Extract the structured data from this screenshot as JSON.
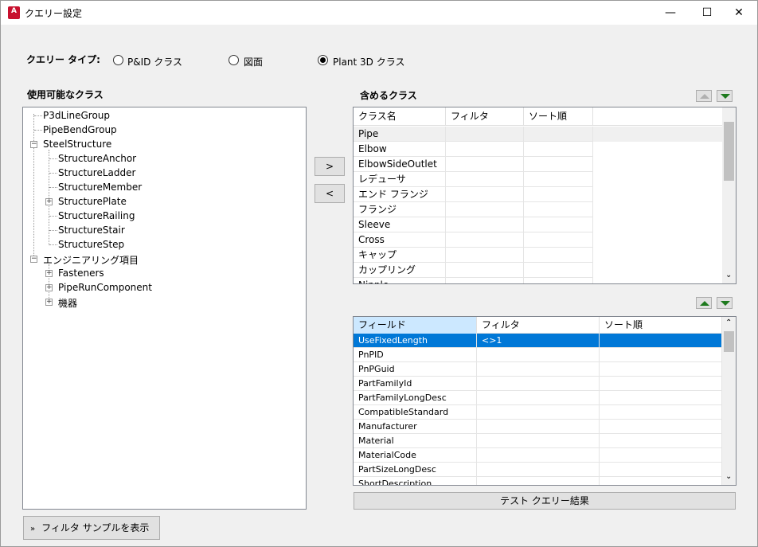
{
  "window": {
    "title": "クエリー設定",
    "icon": "autocad-plant-icon",
    "app_icon_letter": "A"
  },
  "query_type": {
    "label": "クエリー タイプ:",
    "options": [
      {
        "label": "P&ID クラス",
        "selected": false
      },
      {
        "label": "図面",
        "selected": false
      },
      {
        "label": "Plant 3D クラス",
        "selected": true
      }
    ]
  },
  "available": {
    "title": "使用可能なクラス",
    "tree": [
      {
        "label": "P3dLineGroup"
      },
      {
        "label": "PipeBendGroup"
      },
      {
        "label": "SteelStructure",
        "expanded": true
      },
      {
        "label": "StructureAnchor"
      },
      {
        "label": "StructureLadder"
      },
      {
        "label": "StructureMember"
      },
      {
        "label": "StructurePlate",
        "expandable": true
      },
      {
        "label": "StructureRailing"
      },
      {
        "label": "StructureStair"
      },
      {
        "label": "StructureStep"
      },
      {
        "label": "エンジニアリング項目",
        "expanded": true
      },
      {
        "label": "Fasteners",
        "expandable": true
      },
      {
        "label": "PipeRunComponent",
        "expandable": true
      },
      {
        "label": "機器",
        "expandable": true
      }
    ]
  },
  "move": {
    "add": ">",
    "remove": "<"
  },
  "included": {
    "title": "含めるクラス",
    "columns": [
      "クラス名",
      "フィルタ",
      "ソート順"
    ],
    "rows": [
      [
        "Pipe",
        "",
        ""
      ],
      [
        "Elbow",
        "",
        ""
      ],
      [
        "ElbowSideOutlet",
        "",
        ""
      ],
      [
        "レデューサ",
        "",
        ""
      ],
      [
        "エンド フランジ",
        "",
        ""
      ],
      [
        "フランジ",
        "",
        ""
      ],
      [
        "Sleeve",
        "",
        ""
      ],
      [
        "Cross",
        "",
        ""
      ],
      [
        "キャップ",
        "",
        ""
      ],
      [
        "カップリング",
        "",
        ""
      ],
      [
        "Nipple",
        "",
        ""
      ]
    ]
  },
  "fields": {
    "columns": [
      "フィールド",
      "フィルタ",
      "ソート順"
    ],
    "rows": [
      [
        "UseFixedLength",
        "<>1",
        ""
      ],
      [
        "PnPID",
        "",
        ""
      ],
      [
        "PnPGuid",
        "",
        ""
      ],
      [
        "PartFamilyId",
        "",
        ""
      ],
      [
        "PartFamilyLongDesc",
        "",
        ""
      ],
      [
        "CompatibleStandard",
        "",
        ""
      ],
      [
        "Manufacturer",
        "",
        ""
      ],
      [
        "Material",
        "",
        ""
      ],
      [
        "MaterialCode",
        "",
        ""
      ],
      [
        "PartSizeLongDesc",
        "",
        ""
      ],
      [
        "ShortDescription",
        "",
        ""
      ]
    ]
  },
  "test_button": "テスト クエリー結果",
  "sample_button": "フィルタ サンプルを表示",
  "colors": {
    "selection": "#0078d7",
    "header_selected": "#cce8ff",
    "accent_arrow": "#1e7a1e"
  }
}
